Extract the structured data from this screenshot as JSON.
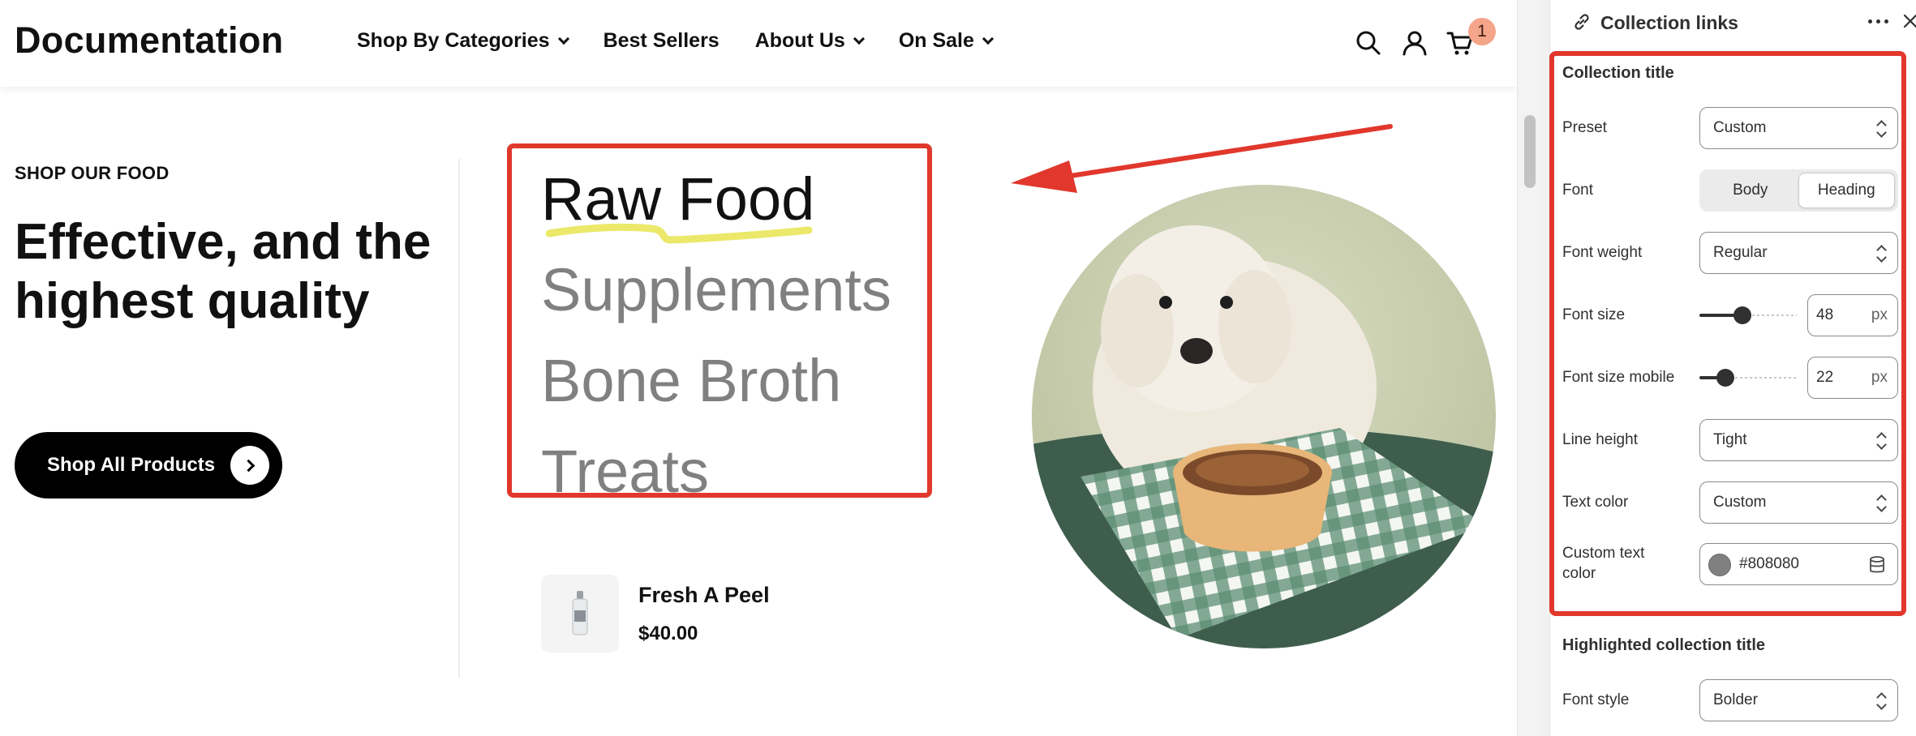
{
  "header": {
    "logo": "Documentation",
    "nav": [
      {
        "label": "Shop By Categories",
        "has_dropdown": true
      },
      {
        "label": "Best Sellers",
        "has_dropdown": false
      },
      {
        "label": "About Us",
        "has_dropdown": true
      },
      {
        "label": "On Sale",
        "has_dropdown": true
      }
    ],
    "icons": [
      "search-icon",
      "account-icon",
      "cart-icon"
    ],
    "cart_count": "1"
  },
  "hero": {
    "eyebrow": "SHOP OUR FOOD",
    "title": "Effective, and the highest quality",
    "button_label": "Shop All Products"
  },
  "collections": [
    {
      "label": "Raw Food",
      "active": true
    },
    {
      "label": "Supplements",
      "active": false
    },
    {
      "label": "Bone Broth",
      "active": false
    },
    {
      "label": "Treats",
      "active": false
    }
  ],
  "product": {
    "name": "Fresh A Peel",
    "price": "$40.00"
  },
  "panel": {
    "title": "Collection links",
    "section1": {
      "title": "Collection title",
      "preset_label": "Preset",
      "preset_value": "Custom",
      "font_label": "Font",
      "font_options": [
        "Body",
        "Heading"
      ],
      "font_selected": "Heading",
      "font_weight_label": "Font weight",
      "font_weight_value": "Regular",
      "font_size_label": "Font size",
      "font_size_value": "48",
      "font_size_slider": 0.44,
      "font_size_mobile_label": "Font size mobile",
      "font_size_mobile_value": "22",
      "font_size_mobile_slider": 0.27,
      "unit": "px",
      "line_height_label": "Line height",
      "line_height_value": "Tight",
      "text_color_label": "Text color",
      "text_color_value": "Custom",
      "custom_text_color_label": "Custom text color",
      "custom_text_color_value": "#808080"
    },
    "section2": {
      "title": "Highlighted collection title",
      "font_style_label": "Font style",
      "font_style_value": "Bolder"
    }
  },
  "colors": {
    "accent_red": "#e1372c",
    "badge": "#f4a58a",
    "muted_text": "#808080",
    "squiggle": "#ebe86a"
  }
}
